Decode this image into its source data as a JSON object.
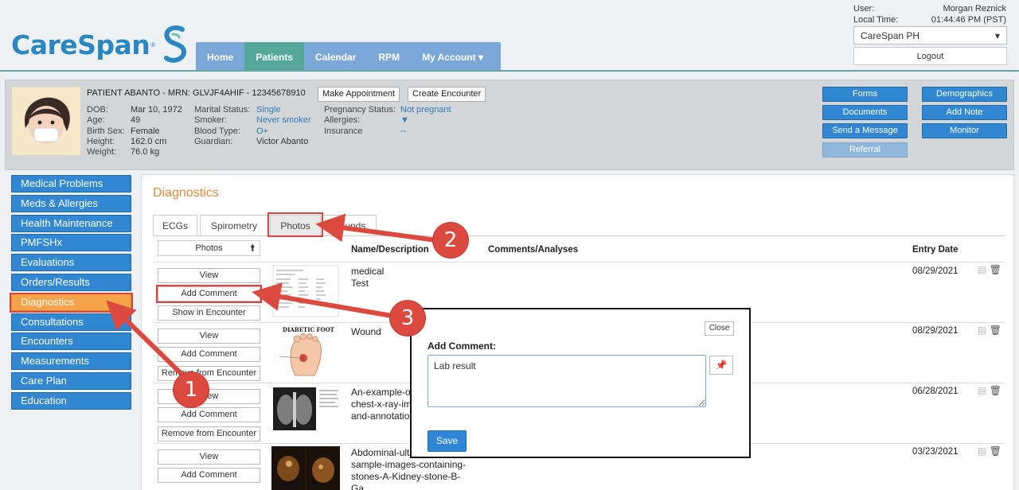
{
  "brand": {
    "name": "CareSpan",
    "reg": "®"
  },
  "nav": [
    {
      "label": "Home"
    },
    {
      "label": "Patients"
    },
    {
      "label": "Calendar"
    },
    {
      "label": "RPM"
    },
    {
      "label": "My Account ▾"
    }
  ],
  "user": {
    "user_label": "User:",
    "user_value": "Morgan Reznick",
    "time_label": "Local Time:",
    "time_value": "01:44:46 PM (PST)",
    "clinic": "CareSpan PH",
    "logout": "Logout"
  },
  "patient": {
    "title": "PATIENT ABANTO - MRN: GLVJF4AHIF - 12345678910",
    "make_appointment": "Make Appointment",
    "create_encounter": "Create Encounter",
    "col1": {
      "dob_k": "DOB:",
      "dob_v": "Mar 10, 1972",
      "age_k": "Age:",
      "age_v": "49",
      "sex_k": "Birth Sex:",
      "sex_v": "Female",
      "height_k": "Height:",
      "height_v": "162.0 cm",
      "weight_k": "Weight:",
      "weight_v": "76.0 kg"
    },
    "col2": {
      "marital_k": "Marital Status:",
      "marital_v": "Single",
      "smoker_k": "Smoker:",
      "smoker_v": "Never smoker",
      "blood_k": "Blood Type:",
      "blood_v": "O+",
      "guardian_k": "Guardian:",
      "guardian_v": "Victor Abanto"
    },
    "col3": {
      "preg_k": "Pregnancy Status:",
      "preg_v": "Not pregnant",
      "allergies_k": "Allergies:",
      "insurance_k": "Insurance",
      "insurance_v": "--"
    },
    "actions": {
      "forms": "Forms",
      "documents": "Documents",
      "send_message": "Send a Message",
      "referral": "Referral",
      "demographics": "Demographics",
      "add_note": "Add Note",
      "monitor": "Monitor"
    }
  },
  "menu": [
    "Medical Problems",
    "Meds & Allergies",
    "Health Maintenance",
    "PMFSHx",
    "Evaluations",
    "Orders/Results",
    "Diagnostics",
    "Consultations",
    "Encounters",
    "Measurements",
    "Care Plan",
    "Education"
  ],
  "diagnostics": {
    "title": "Diagnostics",
    "tabs": [
      "ECGs",
      "Spirometry",
      "Photos",
      "Sounds"
    ],
    "sort_label": "Photos",
    "headers": {
      "name": "Name/Description",
      "comments": "Comments/Analyses",
      "date": "Entry Date"
    },
    "rows": [
      {
        "view": "View",
        "add_comment": "Add Comment",
        "third": "Show in Encounter",
        "desc_line1": "medical",
        "desc_line2": "Test",
        "date": "08/29/2021"
      },
      {
        "view": "View",
        "add_comment": "Add Comment",
        "third": "Remove from Encounter",
        "desc_line1": "Wound",
        "desc_line2": "",
        "date": "08/29/2021"
      },
      {
        "view": "View",
        "add_comment": "Add Comment",
        "third": "Remove from Encounter",
        "desc_line1": "An-example-of-",
        "desc_line2": "chest-x-ray-im",
        "desc_line3": "and-annotatio",
        "date": "06/28/2021"
      },
      {
        "view": "View",
        "add_comment": "Add Comment",
        "third": "",
        "desc_line1": "Abdominal-ult",
        "desc_line2": "sample-images-containing-",
        "desc_line3": "stones-A-Kidney-stone-B-",
        "desc_line4": "Ga",
        "date": "03/23/2021"
      }
    ],
    "thumb2_title": "DIABETIC FOOT"
  },
  "modal": {
    "close": "Close",
    "label": "Add Comment:",
    "value": "Lab result",
    "save": "Save"
  },
  "callouts": [
    "1",
    "2",
    "3"
  ],
  "colors": {
    "accent": "#3187d2",
    "active_menu": "#f5a349",
    "annotation": "#d9433b",
    "nav": "#7aa7d6",
    "nav_active": "#53a89a"
  }
}
